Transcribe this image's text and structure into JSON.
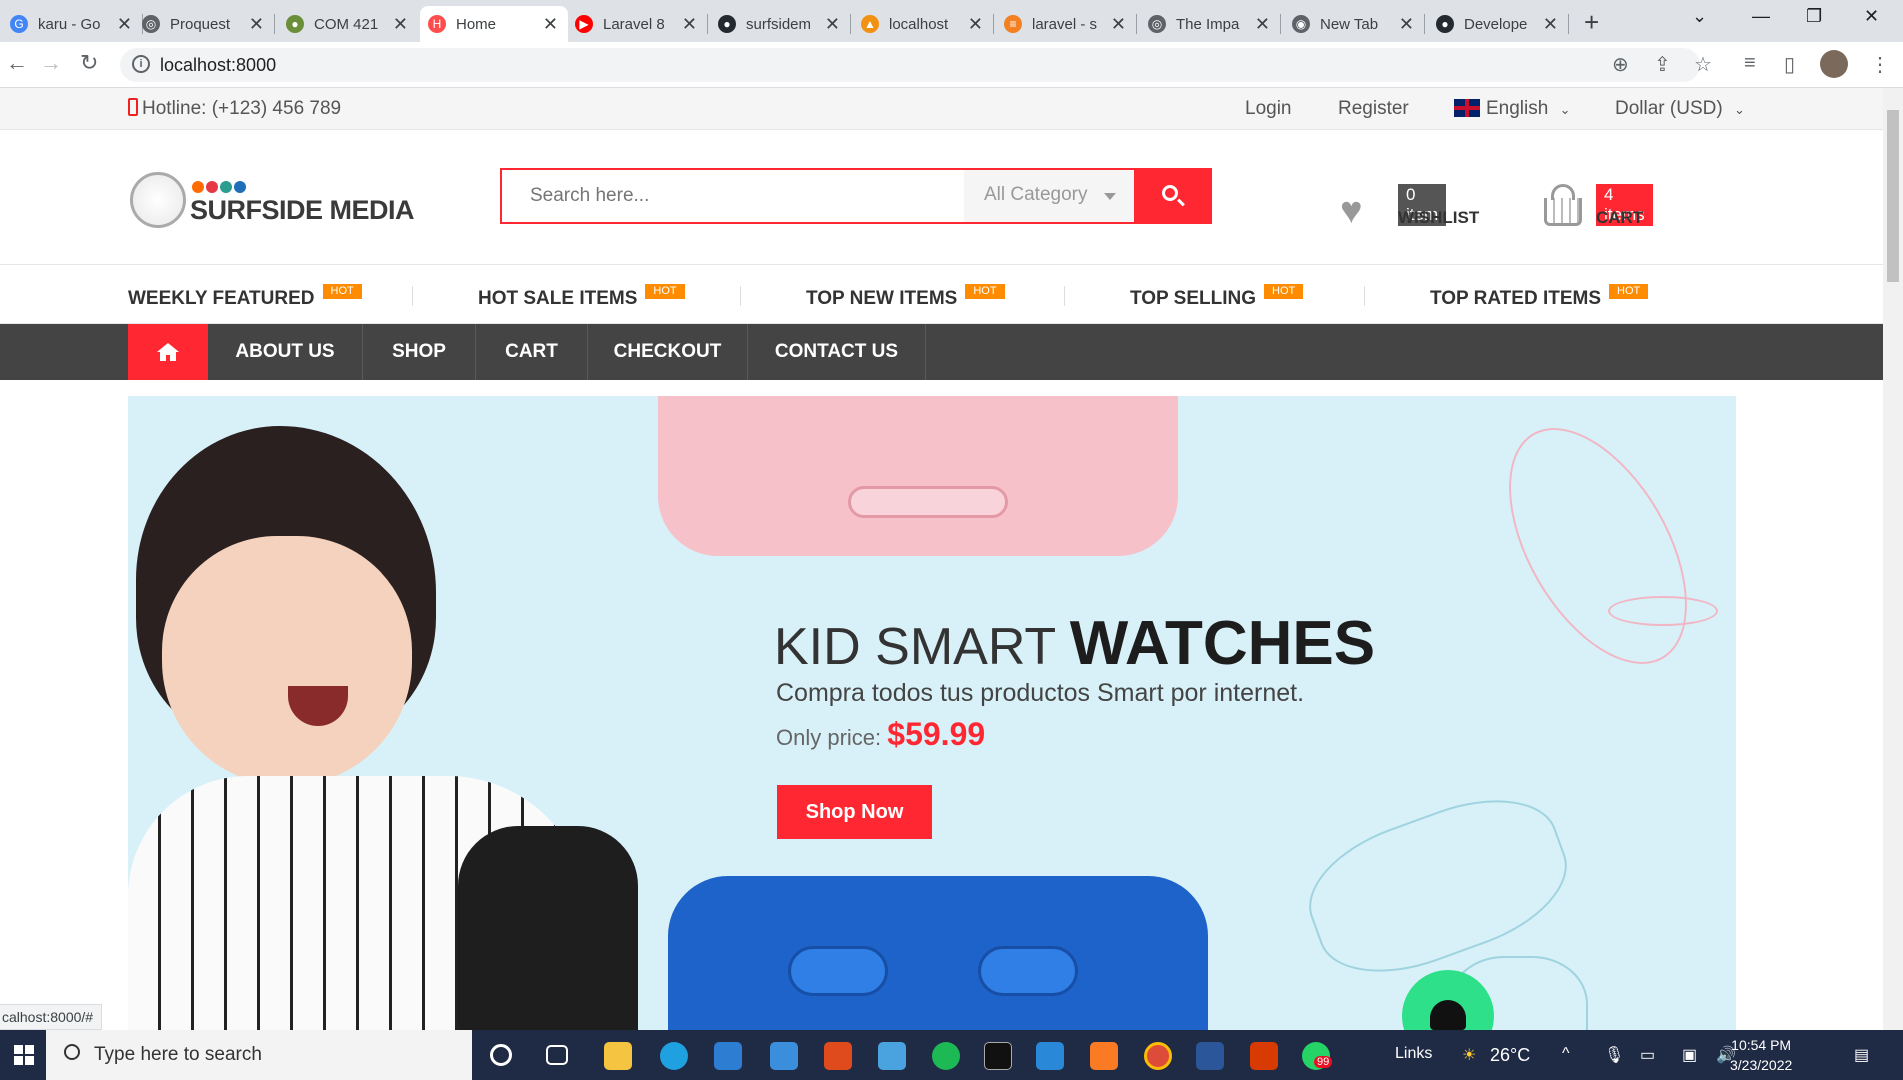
{
  "browser": {
    "tabs": [
      {
        "title": "karu - Go",
        "color": "#4285f4",
        "glyph": "G"
      },
      {
        "title": "Proquest",
        "color": "#5f6368",
        "glyph": "◎"
      },
      {
        "title": "COM 421",
        "color": "#6a8e3a",
        "glyph": "●"
      },
      {
        "title": "Home",
        "color": "#ff4d4d",
        "glyph": "H"
      },
      {
        "title": "Laravel 8",
        "color": "#ff0000",
        "glyph": "▶"
      },
      {
        "title": "surfsidem",
        "color": "#24292f",
        "glyph": "●"
      },
      {
        "title": "localhost",
        "color": "#f29111",
        "glyph": "▲"
      },
      {
        "title": "laravel - s",
        "color": "#f48024",
        "glyph": "≡"
      },
      {
        "title": "The Impa",
        "color": "#5f6368",
        "glyph": "◎"
      },
      {
        "title": "New Tab",
        "color": "#5f6368",
        "glyph": "◉"
      },
      {
        "title": "Develope",
        "color": "#24292f",
        "glyph": "●"
      }
    ],
    "url": "localhost:8000",
    "status_url": "calhost:8000/#"
  },
  "topbar": {
    "hotline": "Hotline: (+123) 456 789",
    "login": "Login",
    "register": "Register",
    "language": "English",
    "currency": "Dollar (USD)"
  },
  "header": {
    "logo_name": "SURFSIDE MEDIA",
    "search_placeholder": "Search here...",
    "category": "All Category",
    "wishlist_count": "0 item",
    "wishlist_label": "WISHLIST",
    "cart_count": "4 items",
    "cart_label": "CART"
  },
  "categories": [
    {
      "label": "WEEKLY FEATURED",
      "hot": "HOT"
    },
    {
      "label": "HOT SALE ITEMS",
      "hot": "HOT"
    },
    {
      "label": "TOP NEW ITEMS",
      "hot": "HOT"
    },
    {
      "label": "TOP SELLING",
      "hot": "HOT"
    },
    {
      "label": "TOP RATED ITEMS",
      "hot": "HOT"
    }
  ],
  "nav": [
    "ABOUT US",
    "SHOP",
    "CART",
    "CHECKOUT",
    "CONTACT US"
  ],
  "banner": {
    "title_light": "KID SMART",
    "title_bold": "WATCHES",
    "subtitle": "Compra todos tus productos Smart por internet.",
    "price_label": "Only price:",
    "price": "$59.99",
    "button": "Shop Now"
  },
  "taskbar": {
    "search": "Type here to search",
    "links": "Links",
    "weather": "26°C",
    "time": "10:54 PM",
    "date": "3/23/2022",
    "whatsapp_badge": "99"
  },
  "colors": {
    "accent": "#ff2832",
    "hot": "#ff8c00",
    "nav": "#444444"
  }
}
